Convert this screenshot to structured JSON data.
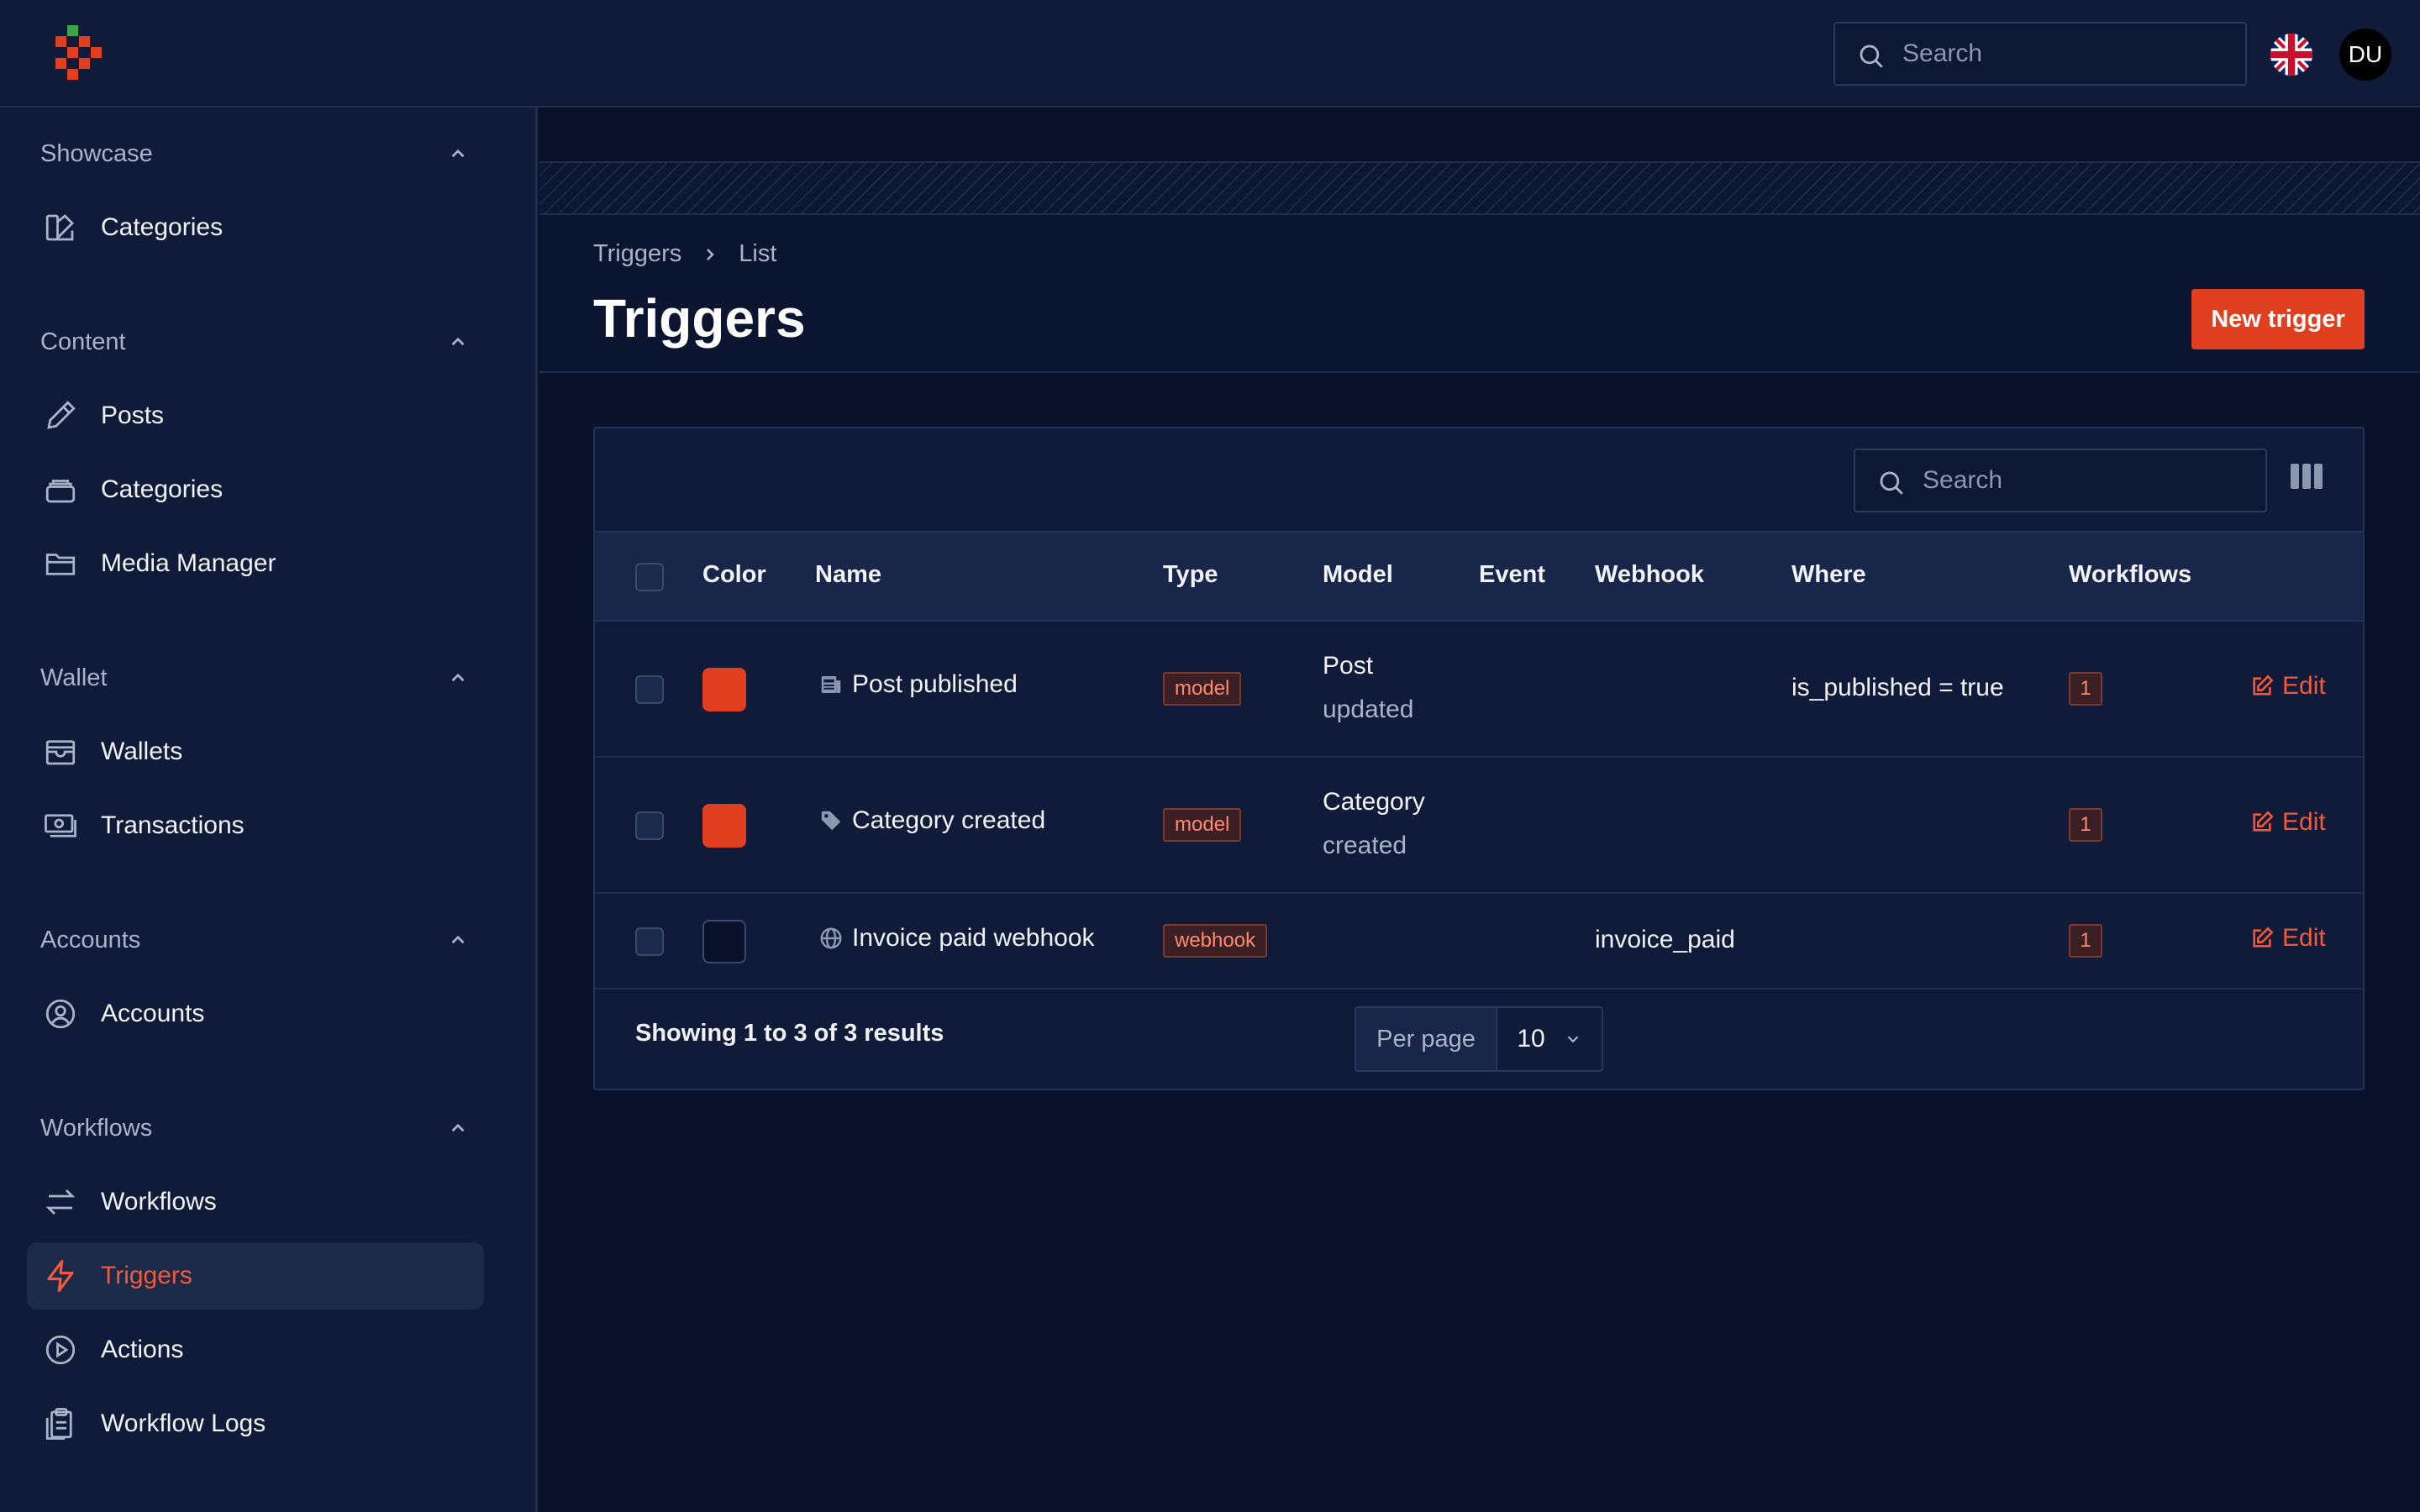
{
  "topbar": {
    "search_placeholder": "Search",
    "avatar_initials": "DU"
  },
  "sidebar": {
    "groups": [
      {
        "label": "Showcase",
        "items": [
          {
            "label": "Categories"
          }
        ]
      },
      {
        "label": "Content",
        "items": [
          {
            "label": "Posts"
          },
          {
            "label": "Categories"
          },
          {
            "label": "Media Manager"
          }
        ]
      },
      {
        "label": "Wallet",
        "items": [
          {
            "label": "Wallets"
          },
          {
            "label": "Transactions"
          }
        ]
      },
      {
        "label": "Accounts",
        "items": [
          {
            "label": "Accounts"
          }
        ]
      },
      {
        "label": "Workflows",
        "items": [
          {
            "label": "Workflows"
          },
          {
            "label": "Triggers",
            "active": true
          },
          {
            "label": "Actions"
          },
          {
            "label": "Workflow Logs"
          }
        ]
      }
    ]
  },
  "header": {
    "breadcrumb": [
      "Triggers",
      "List"
    ],
    "title": "Triggers",
    "new_button": "New trigger"
  },
  "table": {
    "search_placeholder": "Search",
    "columns": [
      "Color",
      "Name",
      "Type",
      "Model",
      "Event",
      "Webhook",
      "Where",
      "Workflows"
    ],
    "rows": [
      {
        "color": "#e0401f",
        "icon": "newspaper-icon",
        "name": "Post published",
        "type": "model",
        "model": "Post",
        "model_event": "updated",
        "event": "",
        "webhook": "",
        "where": "is_published = true",
        "workflows": "1",
        "edit": "Edit"
      },
      {
        "color": "#e0401f",
        "icon": "tag-icon",
        "name": "Category created",
        "type": "model",
        "model": "Category",
        "model_event": "created",
        "event": "",
        "webhook": "",
        "where": "",
        "workflows": "1",
        "edit": "Edit"
      },
      {
        "color": "#0a1229",
        "icon": "globe-icon",
        "name": "Invoice paid webhook",
        "type": "webhook",
        "model": "",
        "model_event": "",
        "event": "",
        "webhook": "invoice_paid",
        "where": "",
        "workflows": "1",
        "edit": "Edit"
      }
    ],
    "footer": {
      "summary": "Showing 1 to 3 of 3 results",
      "per_page_label": "Per page",
      "per_page_value": "10"
    }
  },
  "colors": {
    "accent": "#e0401f",
    "active_text": "#f05a3c",
    "background": "#0a1229",
    "panel": "#0f1b38"
  }
}
